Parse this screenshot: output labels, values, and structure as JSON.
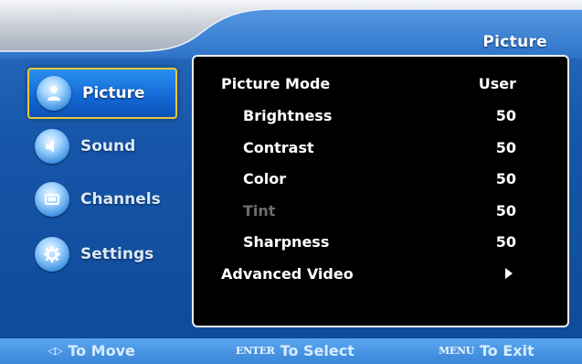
{
  "header": {
    "title": "Picture"
  },
  "menu": {
    "items": [
      {
        "label": "Picture",
        "icon": "person-icon",
        "active": true
      },
      {
        "label": "Sound",
        "icon": "speaker-icon",
        "active": false
      },
      {
        "label": "Channels",
        "icon": "tv-icon",
        "active": false
      },
      {
        "label": "Settings",
        "icon": "gear-icon",
        "active": false
      }
    ]
  },
  "settings": {
    "picture_mode": {
      "label": "Picture Mode",
      "value": "User"
    },
    "brightness": {
      "label": "Brightness",
      "value": "50"
    },
    "contrast": {
      "label": "Contrast",
      "value": "50"
    },
    "color": {
      "label": "Color",
      "value": "50"
    },
    "tint": {
      "label": "Tint",
      "value": "50",
      "disabled": true
    },
    "sharpness": {
      "label": "Sharpness",
      "value": "50"
    },
    "advanced_video": {
      "label": "Advanced Video",
      "icon": "arrow-right-icon"
    }
  },
  "footer": {
    "move": {
      "key_icon": "◁▷",
      "label": "To Move"
    },
    "select": {
      "key": "ENTER",
      "label": "To Select"
    },
    "exit": {
      "key": "MENU",
      "label": "To Exit"
    }
  },
  "colors": {
    "background": "#1655a8",
    "panel": "#000000",
    "active_border": "#e9c83b",
    "disabled_text": "#6e6e6e"
  }
}
